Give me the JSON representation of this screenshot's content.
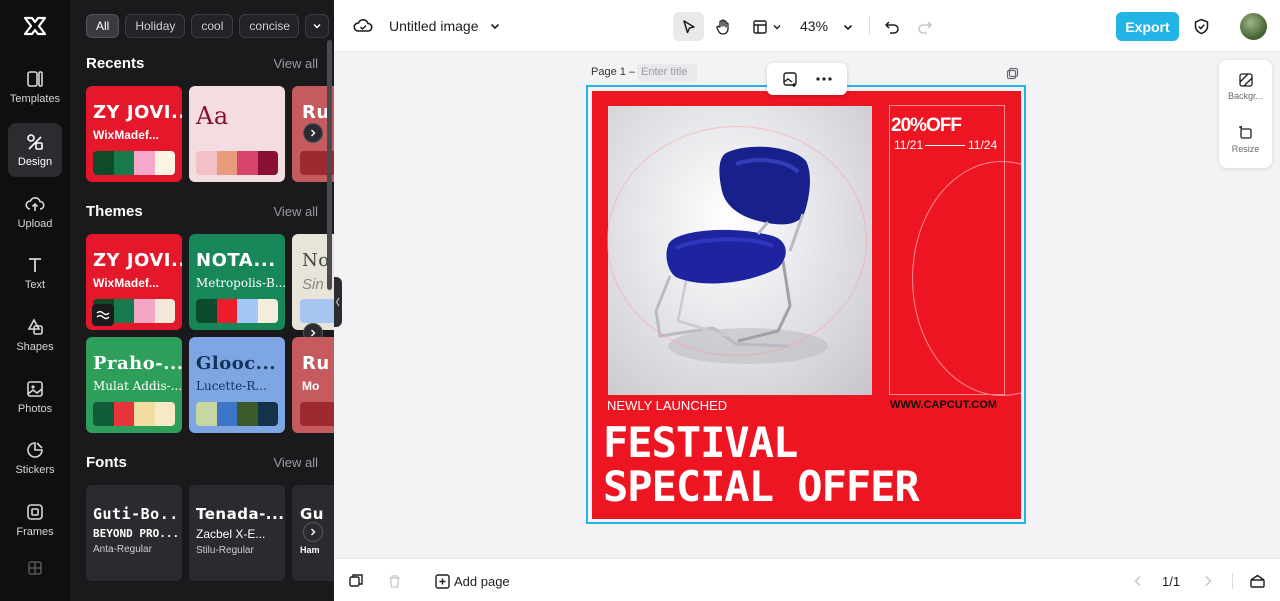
{
  "rail": {
    "items": [
      {
        "label": "Templates",
        "icon": "templates-icon"
      },
      {
        "label": "Design",
        "icon": "design-icon"
      },
      {
        "label": "Upload",
        "icon": "upload-icon"
      },
      {
        "label": "Text",
        "icon": "text-icon"
      },
      {
        "label": "Shapes",
        "icon": "shapes-icon"
      },
      {
        "label": "Photos",
        "icon": "photos-icon"
      },
      {
        "label": "Stickers",
        "icon": "stickers-icon"
      },
      {
        "label": "Frames",
        "icon": "frames-icon"
      }
    ]
  },
  "panel": {
    "chips": [
      "All",
      "Holiday",
      "cool",
      "concise"
    ],
    "recents": {
      "title": "Recents",
      "view_all": "View all",
      "cards": [
        {
          "t1": "ZY JOVI...",
          "t2": "WixMadef...",
          "bg": "#e5172a",
          "palette": [
            "#0f4a2a",
            "#177a4c",
            "#f7a8c8",
            "#fbf4e3"
          ]
        },
        {
          "t1": "Aa",
          "t2": "",
          "bg": "#f3dde1",
          "palette": [
            "#f3c0c8",
            "#e89b7d",
            "#d7456f",
            "#8a0f34"
          ]
        },
        {
          "t1": "Ru",
          "t2": "",
          "bg": "#c55b5e",
          "palette": [
            "#9e2a30"
          ]
        }
      ]
    },
    "themes": {
      "title": "Themes",
      "view_all": "View all",
      "cards": [
        {
          "t1": "ZY JOVI...",
          "t2": "WixMadef...",
          "bg": "#e5172a",
          "palette": [
            "#0f4a2a",
            "#177a4c",
            "#f3a6c4",
            "#f2e8da"
          ]
        },
        {
          "t1": "NOTA...",
          "t2": "Metropolis-B...",
          "bg": "#17875a",
          "palette": [
            "#0b4a2d",
            "#ef1c2c",
            "#a5c7f5",
            "#f4ecdd"
          ]
        },
        {
          "t1": "No",
          "t2": "Sin",
          "bg": "#e9e4da",
          "palette": [
            "#a8c4f0"
          ]
        },
        {
          "t1": "Praho-...",
          "t2": "Mulat Addis-...",
          "bg": "#2e9e5b",
          "palette": [
            "#0f5b3a",
            "#e6343b",
            "#f3dca0",
            "#f7e9c8"
          ]
        },
        {
          "t1": "Glooc...",
          "t2": "Lucette-R...",
          "bg": "#7ea6e3",
          "palette": [
            "#c8d6a2",
            "#3d76c7",
            "#3c5b2c",
            "#16324a"
          ]
        },
        {
          "t1": "Ru",
          "t2": "Mo",
          "bg": "#c55b5e",
          "palette": [
            "#9e2a30"
          ]
        }
      ]
    },
    "fonts": {
      "title": "Fonts",
      "view_all": "View all",
      "cards": [
        {
          "t1": "Guti-Bo...",
          "t2": "BEYOND PRO...",
          "t3": "Anta-Regular"
        },
        {
          "t1": "Tenada-...",
          "t2": "Zacbel X-E...",
          "t3": "Stilu-Regular"
        },
        {
          "t1": "Gu",
          "t2": "",
          "t3": "Ham"
        }
      ]
    }
  },
  "topbar": {
    "doc_title": "Untitled image",
    "zoom": "43%",
    "export_label": "Export"
  },
  "canvas": {
    "page_label": "Page 1 –",
    "title_placeholder": "Enter title",
    "poster": {
      "discount": "20%OFF",
      "date_start": "11/21",
      "date_end": "11/24",
      "tagline": "NEWLY LAUNCHED",
      "website": "WWW.CAPCUT.COM",
      "headline_1": "FESTIVAL",
      "headline_2": "SPECIAL OFFER",
      "bg_color": "#ee1522"
    }
  },
  "side_tools": [
    {
      "label": "Backgr...",
      "icon": "background-icon"
    },
    {
      "label": "Resize",
      "icon": "resize-icon"
    }
  ],
  "bottombar": {
    "add_page": "Add page",
    "page_count": "1/1"
  },
  "colors": {
    "accent": "#23b4e6",
    "rail_bg": "#0f0f10",
    "panel_bg": "#1a1a1c"
  }
}
